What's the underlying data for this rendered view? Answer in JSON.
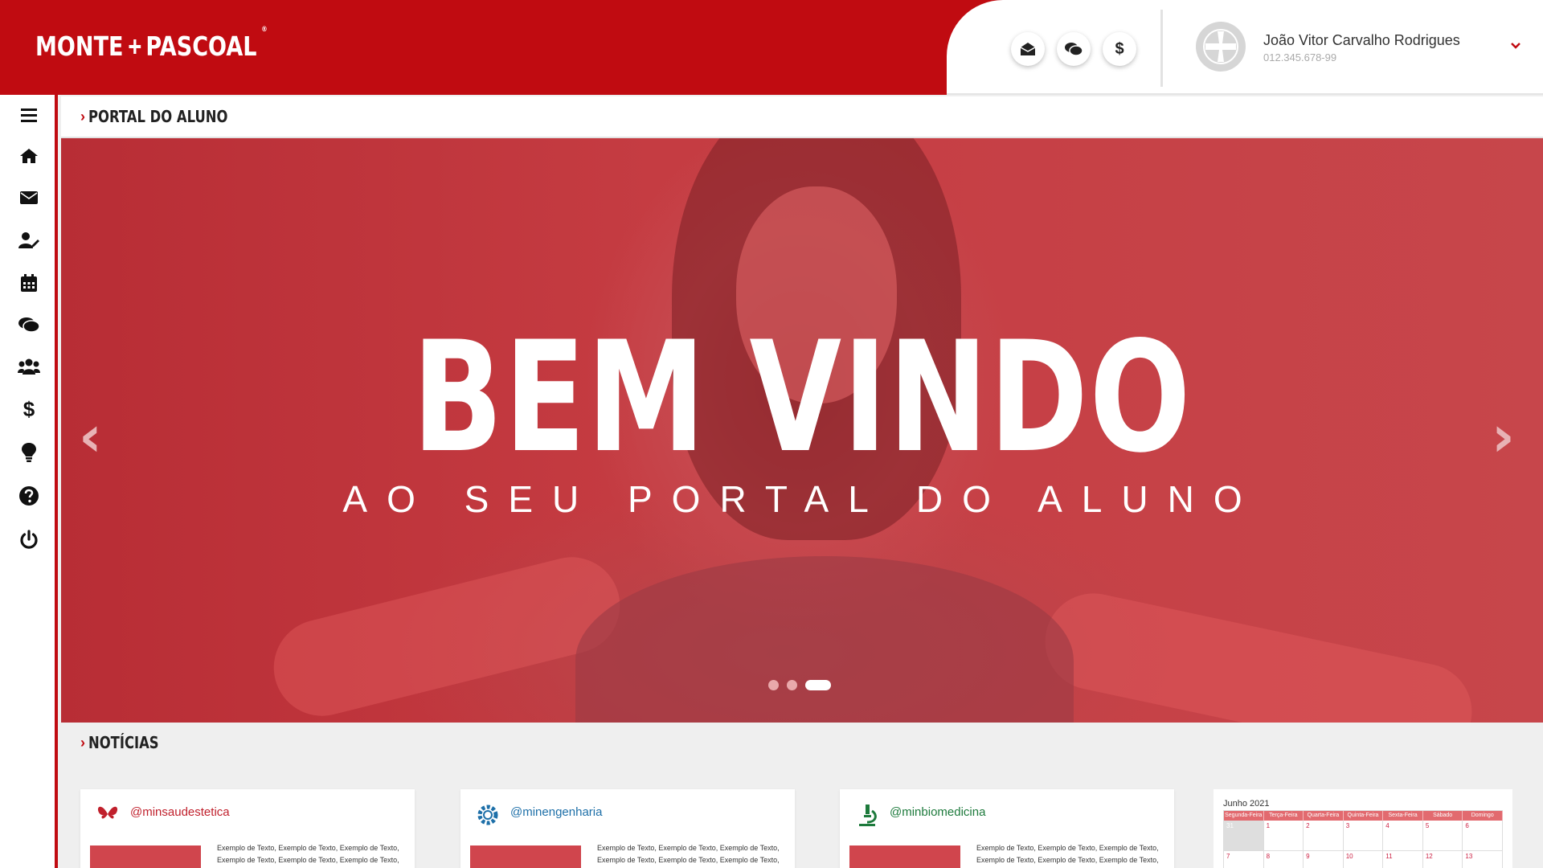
{
  "brand": {
    "logo_left": "MONTE",
    "logo_right": "PASCOAL",
    "reg": "®"
  },
  "header": {
    "actions": [
      {
        "icon": "envelope-open-icon"
      },
      {
        "icon": "chat-icon"
      },
      {
        "icon": "dollar-icon",
        "glyph": "$"
      }
    ],
    "user": {
      "name": "João Vitor Carvalho Rodrigues",
      "id": "012.345.678-99"
    }
  },
  "sidebar": {
    "items": [
      {
        "icon": "menu-icon"
      },
      {
        "icon": "home-icon"
      },
      {
        "icon": "envelope-icon"
      },
      {
        "icon": "user-edit-icon"
      },
      {
        "icon": "calendar-icon"
      },
      {
        "icon": "chat-icon"
      },
      {
        "icon": "users-icon"
      },
      {
        "icon": "dollar-icon"
      },
      {
        "icon": "lightbulb-icon"
      },
      {
        "icon": "help-icon"
      },
      {
        "icon": "power-icon"
      }
    ]
  },
  "breadcrumb": {
    "arrow": "›",
    "label": "PORTAL DO ALUNO"
  },
  "hero": {
    "title": "BEM VINDO",
    "subtitle": "AO SEU PORTAL DO ALUNO",
    "prev": "‹",
    "next": "›",
    "slides": 3,
    "active_slide": 3
  },
  "news": {
    "arrow": "›",
    "title": "NOTÍCIAS",
    "cards": [
      {
        "handle": "@minsaudestetica",
        "handle_color": "#c0202c",
        "text": "Exemplo de Texto, Exemplo de Texto, Exemplo de Texto, Exemplo de Texto, Exemplo de Texto, Exemplo de Texto,"
      },
      {
        "handle": "@minengenharia",
        "handle_color": "#1d6fa8",
        "text": "Exemplo de Texto, Exemplo de Texto, Exemplo de Texto, Exemplo de Texto, Exemplo de Texto, Exemplo de Texto,"
      },
      {
        "handle": "@minbiomedicina",
        "handle_color": "#1d7a3c",
        "text": "Exemplo de Texto, Exemplo de Texto, Exemplo de Texto, Exemplo de Texto, Exemplo de Texto, Exemplo de Texto,"
      }
    ]
  },
  "calendar": {
    "title": "Junho 2021",
    "days": [
      "Segunda-Feira",
      "Terça-Feira",
      "Quarta-Feira",
      "Quinta-Feira",
      "Sexta-Feira",
      "Sábado",
      "Domingo"
    ],
    "week1": [
      "31",
      "1",
      "2",
      "3",
      "4",
      "5",
      "6"
    ],
    "week2": [
      "7",
      "8",
      "9",
      "10",
      "11",
      "12",
      "13"
    ]
  },
  "colors": {
    "brand_red": "#c00b11",
    "white": "#ffffff"
  }
}
